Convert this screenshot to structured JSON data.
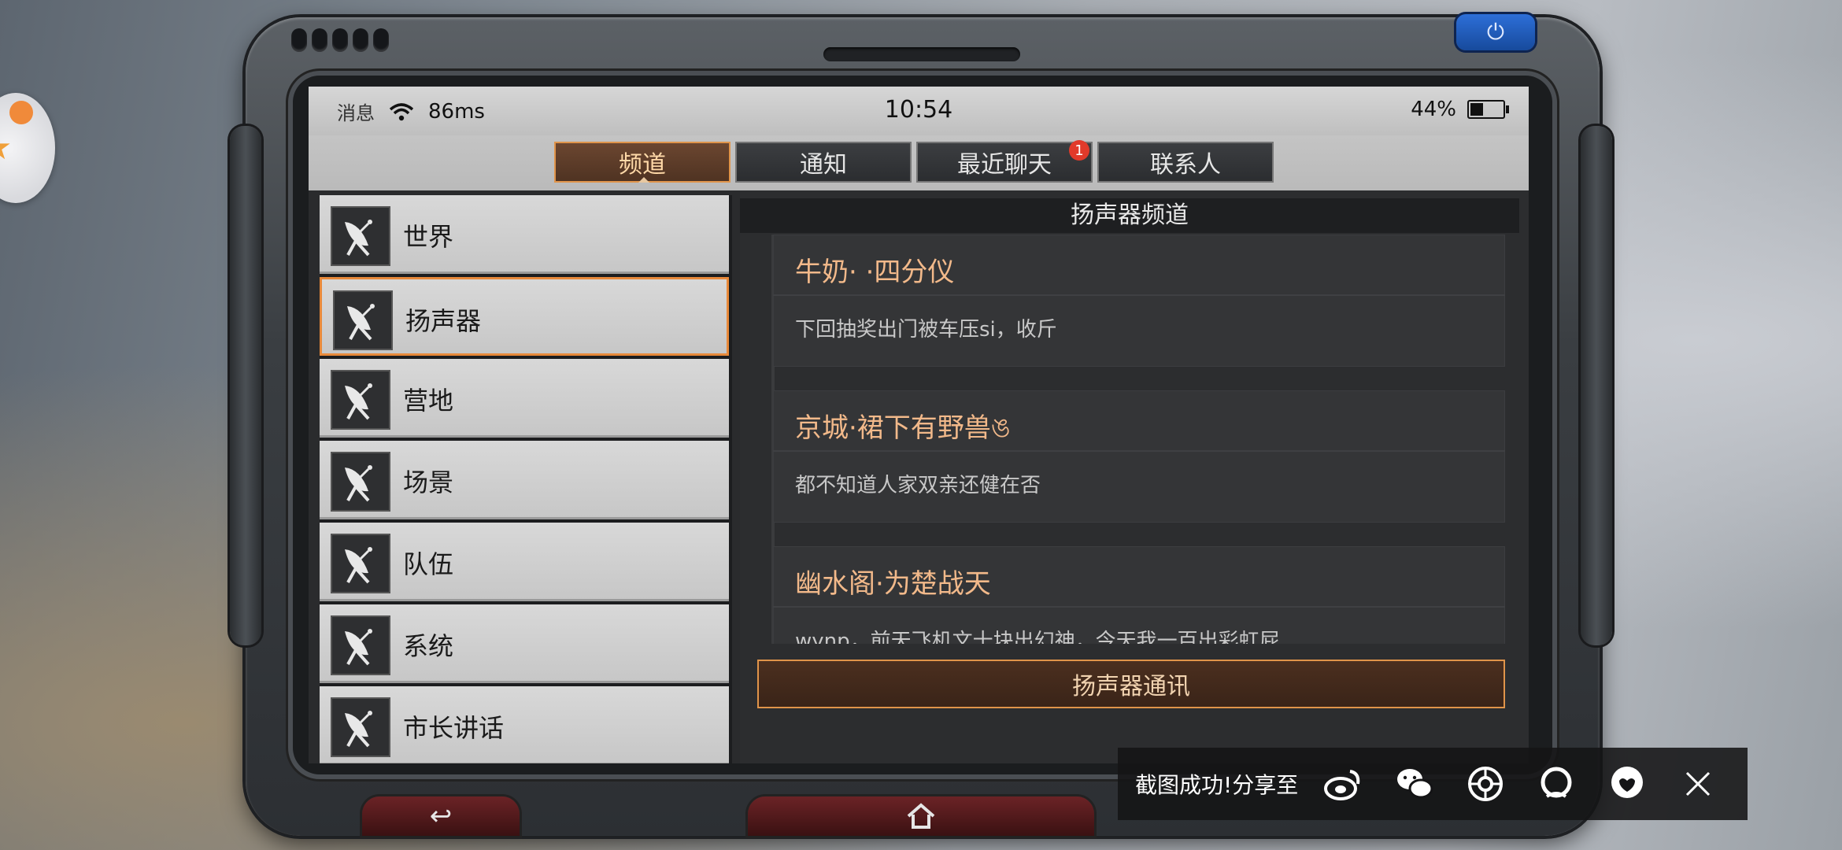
{
  "status_bar": {
    "messages_label": "消息",
    "latency": "86ms",
    "time": "10:54",
    "battery_percent": "44%",
    "battery_level": 0.44
  },
  "tabs": [
    {
      "label": "频道",
      "active": true
    },
    {
      "label": "通知",
      "active": false
    },
    {
      "label": "最近聊天",
      "active": false,
      "badge": "1"
    },
    {
      "label": "联系人",
      "active": false
    }
  ],
  "channels": [
    {
      "label": "世界"
    },
    {
      "label": "扬声器",
      "active": true
    },
    {
      "label": "营地"
    },
    {
      "label": "场景"
    },
    {
      "label": "队伍"
    },
    {
      "label": "系统"
    },
    {
      "label": "市长讲话"
    }
  ],
  "feed": {
    "title": "扬声器频道",
    "messages": [
      {
        "name": "牛奶· ·四分仪",
        "text": "下回抽奖出门被车压si，收斤"
      },
      {
        "name": "京城·裙下有野兽ঙ",
        "text": "都不知道人家双亲还健在否"
      },
      {
        "name": "幽水阁·为楚战天",
        "text": "wynp，前天飞机文十块出幻神，今天我一百出彩虹屁"
      }
    ],
    "send_button": "扬声器通讯"
  },
  "share": {
    "text": "截图成功!分享至",
    "icons": [
      "weibo-icon",
      "wechat-icon",
      "moments-icon",
      "qq-icon",
      "qzone-icon",
      "close-icon"
    ]
  },
  "colors": {
    "accent": "#e0944a",
    "name_text": "#f2b98a",
    "badge": "#e23a2a"
  }
}
